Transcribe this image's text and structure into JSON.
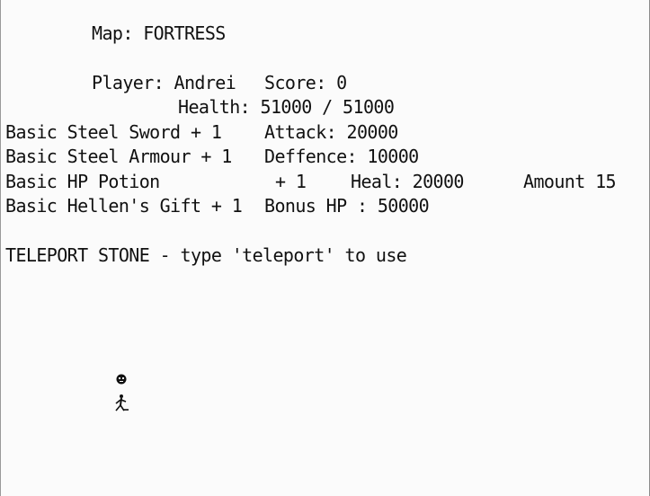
{
  "map_line": "Map: FORTRESS",
  "player": {
    "label": "Player: Andrei",
    "score": "Score: 0",
    "health": "Health: 51000 / 51000"
  },
  "inventory": [
    {
      "item": "Basic Steel Sword + 1",
      "stat": "Attack: 20000"
    },
    {
      "item": "Basic Steel Armour + 1",
      "stat": "Deffence: 10000"
    },
    {
      "item": "Basic HP Potion",
      "plus": "+ 1",
      "stat": "Heal: 20000",
      "amount": "Amount 15"
    },
    {
      "item": "Basic Hellen's Gift + 1",
      "stat": "Bonus HP : 50000"
    }
  ],
  "teleport_hint": "TELEPORT STONE - type 'teleport' to use",
  "sprite": {
    "head_icon": "skull-face-icon",
    "body_icon": "stick-figure-icon"
  }
}
